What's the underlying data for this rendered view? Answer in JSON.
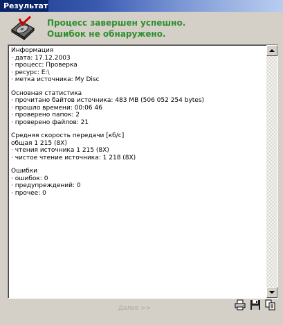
{
  "window": {
    "title": "Результат"
  },
  "status": {
    "line1": "Процесс завершен успешно.",
    "line2": "Ошибок не обнаружено.",
    "color": "#2f8f2f"
  },
  "report": {
    "info": {
      "heading": "Информация",
      "lines": [
        "· дата: 17.12.2003",
        "· процесс: Проверка",
        "· ресурс: E:\\",
        "· метка источника:   My Disc"
      ]
    },
    "stats": {
      "heading": "Основная статистика",
      "lines": [
        "· прочитано байтов источника: 483 MB (506 052 254 bytes)",
        "· прошло времени: 00:06 46",
        "· проверено папок: 2",
        "· проверено файлов: 21"
      ]
    },
    "speed": {
      "heading": "Средняя скорость передачи [кб/с]",
      "lines": [
        " общая  1 215 (8X)",
        "· чтения источника  1 215 (8X)",
        "· чистое чтение источника: 1 218 (8X)"
      ]
    },
    "errors": {
      "heading": "Ошибки",
      "lines": [
        "· ошибок: 0",
        "· предупреждений: 0",
        "· прочее: 0"
      ]
    }
  },
  "buttons": {
    "next": "Далее >>"
  },
  "icons": [
    "disc-icon",
    "print-icon",
    "save-icon",
    "copy-icon"
  ]
}
